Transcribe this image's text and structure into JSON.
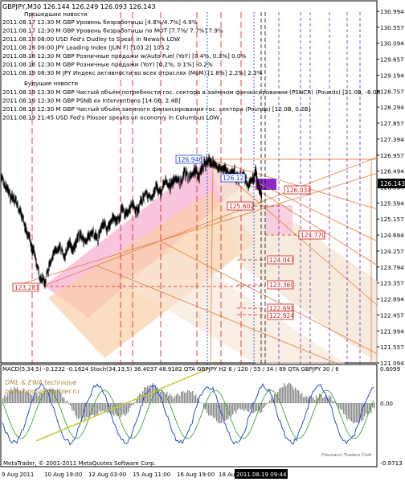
{
  "header": {
    "symbol_line": "GBPJPY,M30  126.144 126.249 126.093 126.143",
    "past_news_title": "Прошедшие новости",
    "future_news_title": "Будущие новости"
  },
  "past_news": [
    "2011.08.17 12:30 M GBP Уровень безработицы [4.8%/4.7%] 4.9%",
    "2011.08.17 12:30 M GBP Уровень безработицы по МОТ [7.7%/ 7.7%] 7.9%",
    "2011.08.18 08:00  USD Fed's Dudley to Speak in Newark  LOW",
    "2011.08.18 09:00  JPY Leading Index (JUN F) [103.2] 103.2",
    "2011.08.18 12:30 M GBP Розничные продажи w/Auto Fuel (YoY) [0.4%, 0.3%] 0.0%",
    "2011.08.18 12:30 M GBP Розничные продажи (YoY) [0.2%, 0.1%] -0.2%",
    "2011.08.19 08:30 M JPY Индекс активности во всех отраслях (MoM) [1.8%] 2.2%] 2.3%"
  ],
  "future_news": [
    "2011.08.19 12:30 M GBP Чистый объём потребности гос. сектора в заёмном финансировании (PSNCR) (Pounds) [21.0B, -8.0B",
    "2011.08.19 12:30 M GBP PSNB ex Interventions [14.0B, 2.4B]",
    "2011.08.19 12:30 M GBP Чистый объём заемного финансирования гос. сектора (Pounds) [12.0B, 0.2B]",
    "2011.08.19 21:45  USD Fed's Plosser speaks on economy in Columbus  LOW"
  ],
  "price_axis": [
    "130.994",
    "130.557",
    "130.094",
    "129.657",
    "129.194",
    "128.757",
    "128.294",
    "127.857",
    "127.394",
    "126.957",
    "126.494",
    "126.034",
    "125.594",
    "125.157",
    "124.694",
    "124.257",
    "123.794",
    "123.357",
    "122.894",
    "122.457",
    "121.994",
    "121.557",
    "121.094"
  ],
  "price_labels": {
    "current": "126.143",
    "high_label": "126.946",
    "low_label": "123.281",
    "l1": "126.034",
    "l2": "125.602",
    "l3": "124.770",
    "l4": "124.047",
    "l5": "123.369",
    "l6": "122.691",
    "l7": "122.924",
    "box_label": "126.12"
  },
  "indicator": {
    "title": "MACD(5,34,5) -0.1232 -0.1624  Stoch(34,13,5) 36.4037 48.9182  QTA GBPJPY H2  6 / 120 / 55 / 34 / 89  QTA GBPJPY 30 / 6",
    "watermark1": "DML & EWA technique",
    "watermark2": "putnik-pou@rambler.ru",
    "axis": [
      "0.6099",
      "0.00",
      "-0.9713"
    ],
    "fib_label": "Fibonacci Traders Club"
  },
  "footer": {
    "copyright": "MetaTrader, © 2001-2011 MetaQuotes Software Corp.",
    "time_axis": [
      "9 Aug 2011",
      "10 Aug 19:00",
      "12 Aug 03:00",
      "15 Aug 11:00",
      "16 Aug 19:00",
      "18 Aug"
    ],
    "time_highlight": "2011.08.19 09:44"
  },
  "colors": {
    "pink_channel": "#f5a0c8",
    "orange_channel": "#f8c89a",
    "cream_channel": "#f7ead8",
    "red_line": "#d01010",
    "purple": "#7a22b8",
    "macd_hist": "#8a8a8a",
    "stoch_blue": "#1838c8"
  }
}
